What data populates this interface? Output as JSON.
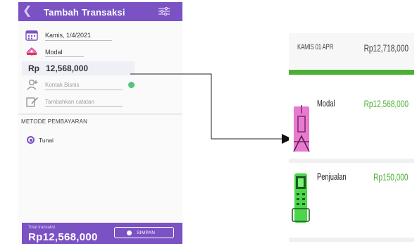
{
  "form": {
    "title": "Tambah Transaksi",
    "date": "Kamis, 1/4/2021",
    "category": "Modal",
    "currency": "Rp",
    "amount": "12,568,000",
    "contact_placeholder": "Kontak Bisnis",
    "note_placeholder": "Tambahkan catatan",
    "payment_section": "METODE PEMBAYARAN",
    "payment_method": "Tunai",
    "total_label": "Total transaksi",
    "total_value": "Rp12,568,000",
    "save_label": "SIMPAN",
    "icons": {
      "back": "back-chevron-icon",
      "settings": "sliders-settings-icon",
      "date": "calendar-icon",
      "category": "money-stack-icon",
      "contact": "person-add-icon",
      "note": "edit-note-icon",
      "save": "check-circle-icon"
    }
  },
  "ledger": {
    "date": "KAMIS 01 APR",
    "day_total": "Rp12,718,000",
    "transactions": [
      {
        "label": "Modal",
        "amount": "Rp12,568,000",
        "icon": "modal-icon",
        "icon_color": "#e87ad0"
      },
      {
        "label": "Penjualan",
        "amount": "Rp150,000",
        "icon": "sales-terminal-icon",
        "icon_color": "#4cd64c"
      }
    ]
  },
  "colors": {
    "primary": "#7b52c4",
    "accent_green": "#4cb035"
  }
}
